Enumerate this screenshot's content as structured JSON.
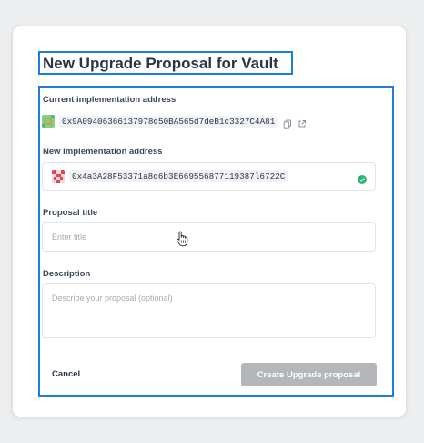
{
  "modal": {
    "title": "New Upgrade Proposal for Vault"
  },
  "current_impl": {
    "label": "Current implementation address",
    "address": "0x9A09406366137978c50BA565d7deB1c3327C4A81",
    "icons": [
      "copy-icon",
      "external-link-icon"
    ]
  },
  "new_impl": {
    "label": "New implementation address",
    "address": "0x4a3A28F53371a8c6b3E669556877119387l6722C",
    "status_icon": "check-circle-icon"
  },
  "proposal_title": {
    "label": "Proposal title",
    "placeholder": "Enter title",
    "value": ""
  },
  "description": {
    "label": "Description",
    "placeholder": "Describe your proposal (optional)",
    "value": ""
  },
  "actions": {
    "cancel_label": "Cancel",
    "create_label": "Create Upgrade proposal"
  },
  "colors": {
    "highlight": "#1a7ee0",
    "success": "#2bb673",
    "disabled_button": "#b4b6ba"
  }
}
